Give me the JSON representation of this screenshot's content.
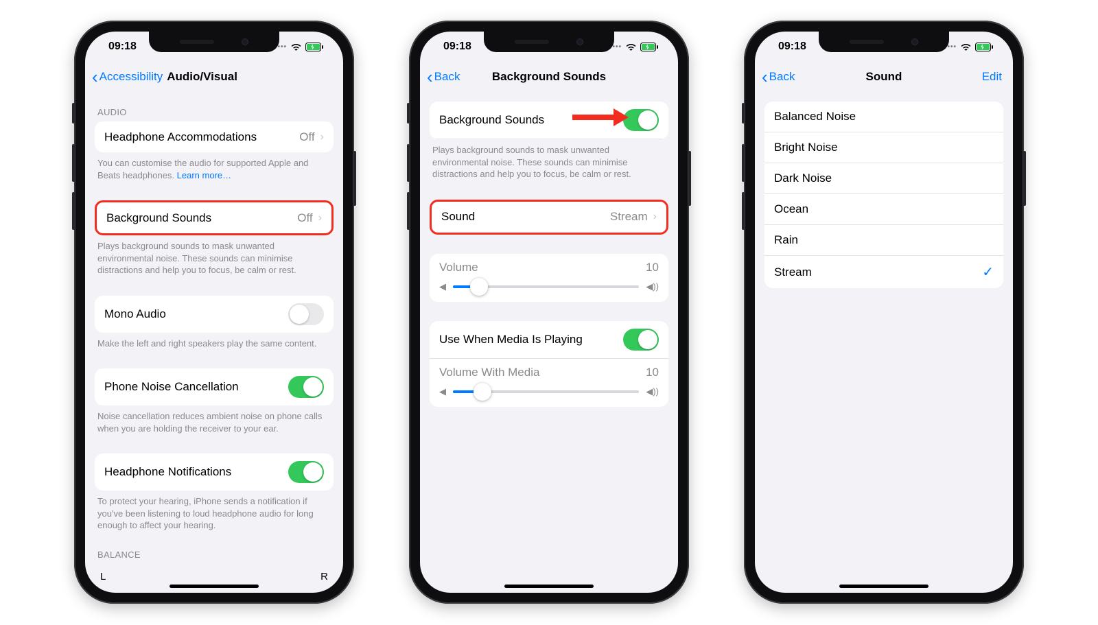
{
  "status": {
    "time": "09:18"
  },
  "phone1": {
    "back": "Accessibility",
    "title": "Audio/Visual",
    "section_audio": "AUDIO",
    "headphone_accom": {
      "label": "Headphone Accommodations",
      "value": "Off"
    },
    "headphone_footer": "You can customise the audio for supported Apple and Beats headphones. ",
    "learn_more": "Learn more…",
    "bg_sounds": {
      "label": "Background Sounds",
      "value": "Off"
    },
    "bg_footer": "Plays background sounds to mask unwanted environmental noise. These sounds can minimise distractions and help you to focus, be calm or rest.",
    "mono": {
      "label": "Mono Audio"
    },
    "mono_footer": "Make the left and right speakers play the same content.",
    "noise": {
      "label": "Phone Noise Cancellation"
    },
    "noise_footer": "Noise cancellation reduces ambient noise on phone calls when you are holding the receiver to your ear.",
    "notif": {
      "label": "Headphone Notifications"
    },
    "notif_footer": "To protect your hearing, iPhone sends a notification if you've been listening to loud headphone audio for long enough to affect your hearing.",
    "section_balance": "BALANCE",
    "balance_l": "L",
    "balance_r": "R"
  },
  "phone2": {
    "back": "Back",
    "title": "Background Sounds",
    "bg_label": "Background Sounds",
    "bg_footer": "Plays background sounds to mask unwanted environmental noise. These sounds can minimise distractions and help you to focus, be calm or rest.",
    "sound": {
      "label": "Sound",
      "value": "Stream"
    },
    "volume": {
      "label": "Volume",
      "value": "10",
      "percent": 14
    },
    "media": {
      "label": "Use When Media Is Playing"
    },
    "vol_media": {
      "label": "Volume With Media",
      "value": "10",
      "percent": 16
    }
  },
  "phone3": {
    "back": "Back",
    "title": "Sound",
    "edit": "Edit",
    "options": [
      "Balanced Noise",
      "Bright Noise",
      "Dark Noise",
      "Ocean",
      "Rain",
      "Stream"
    ],
    "selected": "Stream"
  }
}
